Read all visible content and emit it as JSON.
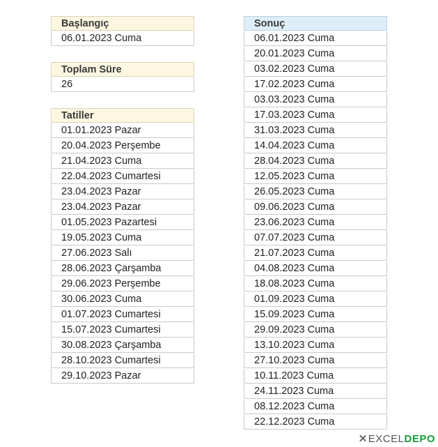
{
  "start": {
    "header": "Başlangıç",
    "value": "06.01.2023 Cuma"
  },
  "total": {
    "header": "Toplam Süre",
    "value": "26"
  },
  "holidays": {
    "header": "Tatiller",
    "items": [
      "01.01.2023 Pazar",
      "20.04.2023 Perşembe",
      "21.04.2023 Cuma",
      "22.04.2023 Cumartesi",
      "23.04.2023 Pazar",
      "23.04.2023 Pazar",
      "01.05.2023 Pazartesi",
      "19.05.2023 Cuma",
      "27.06.2023 Salı",
      "28.06.2023 Çarşamba",
      "29.06.2023 Perşembe",
      "30.06.2023 Cuma",
      "01.07.2023 Cumartesi",
      "15.07.2023 Cumartesi",
      "30.08.2023 Çarşamba",
      "28.10.2023 Cumartesi",
      "29.10.2023 Pazar"
    ]
  },
  "result": {
    "header": "Sonuç",
    "items": [
      "06.01.2023 Cuma",
      "20.01.2023 Cuma",
      "03.02.2023 Cuma",
      "17.02.2023 Cuma",
      "03.03.2023 Cuma",
      "17.03.2023 Cuma",
      "31.03.2023 Cuma",
      "14.04.2023 Cuma",
      "28.04.2023 Cuma",
      "12.05.2023 Cuma",
      "26.05.2023 Cuma",
      "09.06.2023 Cuma",
      "23.06.2023 Cuma",
      "07.07.2023 Cuma",
      "21.07.2023 Cuma",
      "04.08.2023 Cuma",
      "18.08.2023 Cuma",
      "01.09.2023 Cuma",
      "15.09.2023 Cuma",
      "29.09.2023 Cuma",
      "13.10.2023 Cuma",
      "27.10.2023 Cuma",
      "10.11.2023 Cuma",
      "24.11.2023 Cuma",
      "08.12.2023 Cuma",
      "22.12.2023 Cuma"
    ]
  },
  "logo": {
    "prefix": "EXCEL",
    "suffix": "DEPO"
  },
  "colors": {
    "yellow_header": "#fdf7e1",
    "blue_header": "#ddeef9",
    "logo_green": "#1a9a3a"
  }
}
